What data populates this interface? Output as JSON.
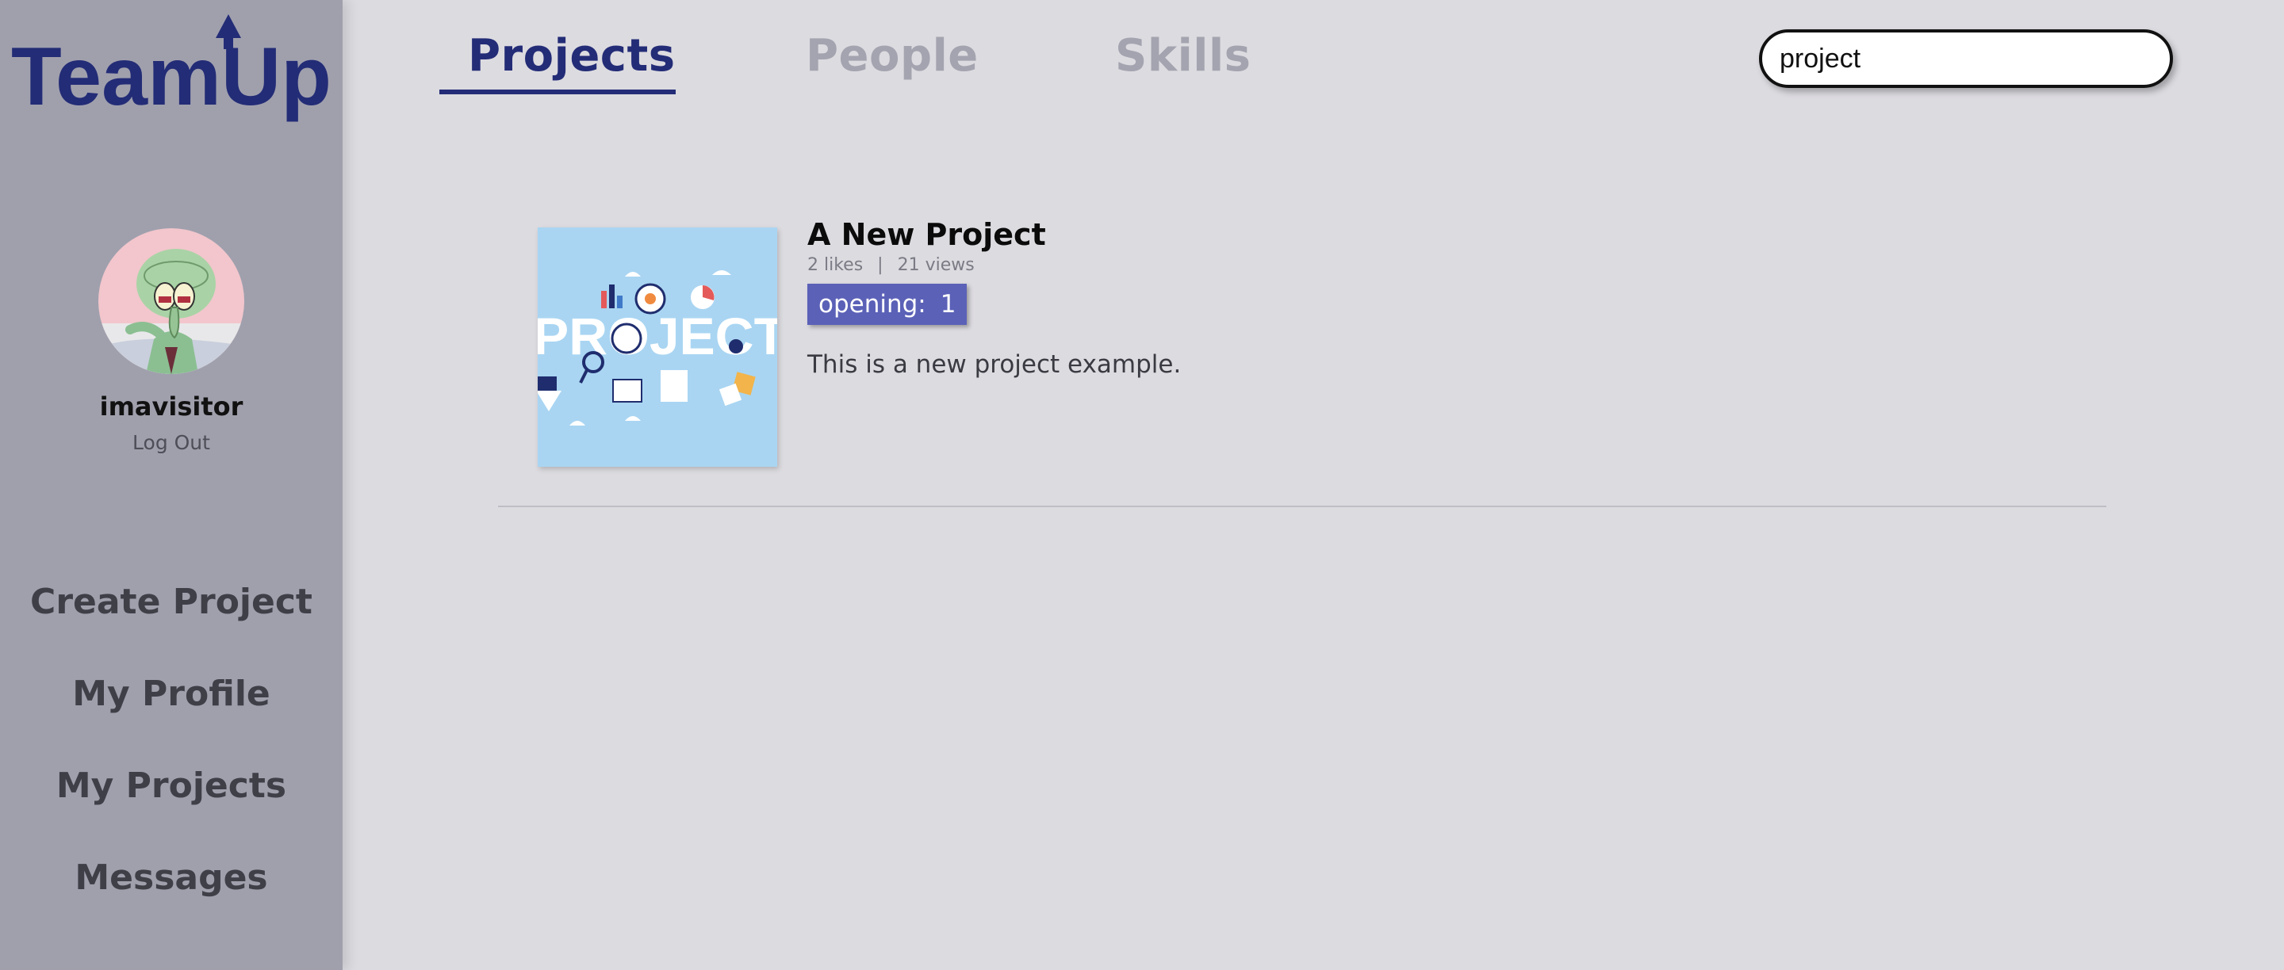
{
  "brand": {
    "logo_text": "TeamUp",
    "color": "#232c76"
  },
  "user": {
    "name": "imavisitor",
    "logout_label": "Log Out"
  },
  "sidebar": {
    "items": [
      {
        "label": "Create Project"
      },
      {
        "label": "My Profile"
      },
      {
        "label": "My Projects"
      },
      {
        "label": "Messages"
      }
    ]
  },
  "tabs": [
    {
      "label": "Projects",
      "active": true
    },
    {
      "label": "People",
      "active": false
    },
    {
      "label": "Skills",
      "active": false
    }
  ],
  "search": {
    "value": "project"
  },
  "results": [
    {
      "title": "A New Project",
      "likes": "2 likes",
      "separator": "|",
      "views": "21 views",
      "opening_label": "opening:",
      "opening_count": "1",
      "description": "This is a new project example.",
      "thumbnail_text": "PROJECT"
    }
  ],
  "colors": {
    "sidebar_bg": "#a0a0ad",
    "page_bg": "#dcdbe0",
    "accent": "#232c76",
    "badge": "#5b61b7",
    "thumbnail_bg": "#a9d5f2"
  }
}
